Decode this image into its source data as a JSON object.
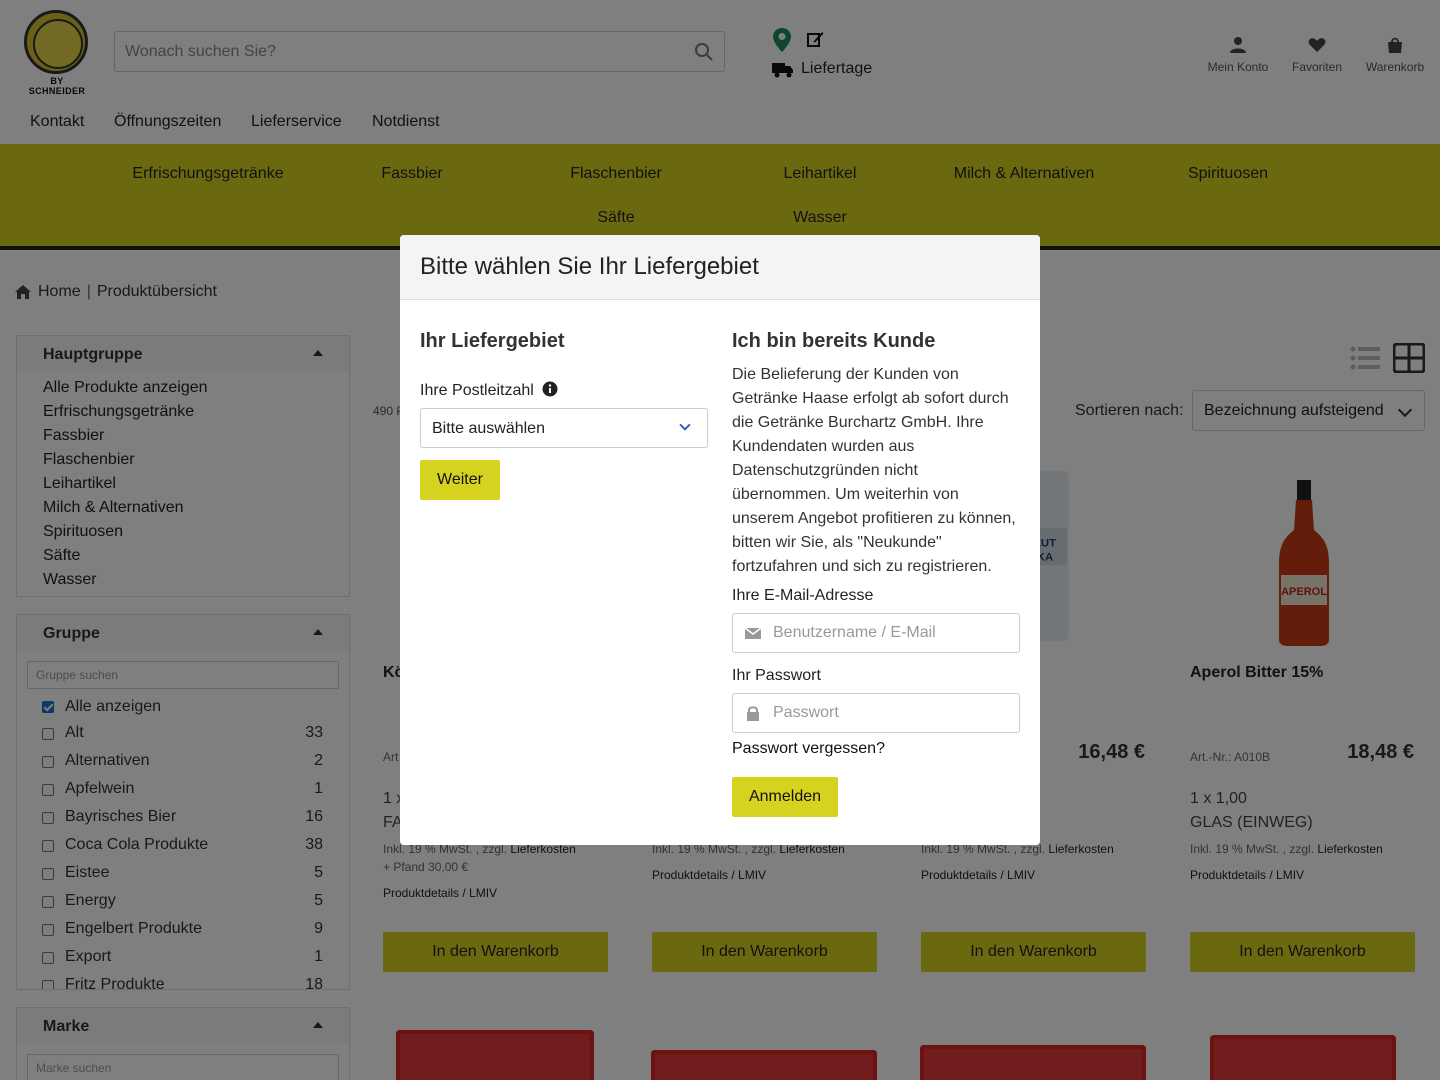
{
  "header": {
    "logo_text": "BY SCHNEIDER",
    "search_placeholder": "Wonach suchen Sie?",
    "liefertage": "Liefertage",
    "account": "Mein Konto",
    "favorites": "Favoriten",
    "cart": "Warenkorb"
  },
  "topnav": [
    "Kontakt",
    "Öffnungszeiten",
    "Lieferservice",
    "Notdienst"
  ],
  "categories": [
    "Erfrischungsgetränke",
    "Fassbier",
    "Flaschenbier",
    "Leihartikel",
    "Milch & Alternativen",
    "Spirituosen",
    "Säfte",
    "Wasser"
  ],
  "breadcrumb": {
    "home": "Home",
    "separator": "|",
    "current": "Produktübersicht"
  },
  "sidebar": {
    "hauptgruppe": {
      "title": "Hauptgruppe",
      "items": [
        "Alle Produkte anzeigen",
        "Erfrischungsgetränke",
        "Fassbier",
        "Flaschenbier",
        "Leihartikel",
        "Milch & Alternativen",
        "Spirituosen",
        "Säfte",
        "Wasser"
      ]
    },
    "gruppe": {
      "title": "Gruppe",
      "search_placeholder": "Gruppe suchen",
      "all_label": "Alle anzeigen",
      "items": [
        {
          "label": "Alt",
          "count": "33"
        },
        {
          "label": "Alternativen",
          "count": "2"
        },
        {
          "label": "Apfelwein",
          "count": "1"
        },
        {
          "label": "Bayrisches Bier",
          "count": "16"
        },
        {
          "label": "Coca Cola Produkte",
          "count": "38"
        },
        {
          "label": "Eistee",
          "count": "5"
        },
        {
          "label": "Energy",
          "count": "5"
        },
        {
          "label": "Engelbert Produkte",
          "count": "9"
        },
        {
          "label": "Export",
          "count": "1"
        },
        {
          "label": "Fritz Produkte",
          "count": "18"
        }
      ]
    },
    "marke": {
      "title": "Marke",
      "search_placeholder": "Marke suchen"
    }
  },
  "listing": {
    "count_text": "490 P",
    "sort_label": "Sortieren nach:",
    "sort_value": "Bezeichnung aufsteigend"
  },
  "products": [
    {
      "title": "Kö",
      "art": "Art",
      "price": "",
      "pack1": "1 x",
      "pack2": "FA",
      "tax_prefix": "Inkl. 19 % MwSt. , zzgl.",
      "tax_link": "Lieferkosten",
      "pfand": "+ Pfand 30,00 €",
      "details": "Produktdetails / LMIV",
      "button": "In den Warenkorb"
    },
    {
      "title": "",
      "art": "",
      "price": "",
      "pack1": "",
      "pack2": "",
      "tax_prefix": "Inkl. 19 % MwSt. , zzgl.",
      "tax_link": "Lieferkosten",
      "pfand": "",
      "details": "Produktdetails / LMIV",
      "button": "In den Warenkorb"
    },
    {
      "title": "",
      "art": "",
      "price": "16,48 €",
      "pack1": "",
      "pack2": "",
      "tax_prefix": "Inkl. 19 % MwSt. , zzgl.",
      "tax_link": "Lieferkosten",
      "pfand": "",
      "details": "Produktdetails / LMIV",
      "button": "In den Warenkorb"
    },
    {
      "title": "Aperol Bitter 15%",
      "art": "Art.-Nr.: A010B",
      "price": "18,48 €",
      "pack1": "1 x 1,00",
      "pack2": "GLAS (EINWEG)",
      "tax_prefix": "Inkl. 19 % MwSt. , zzgl.",
      "tax_link": "Lieferkosten",
      "pfand": "",
      "details": "Produktdetails / LMIV",
      "button": "In den Warenkorb"
    }
  ],
  "modal": {
    "title": "Bitte wählen Sie Ihr Liefergebiet",
    "left_heading": "Ihr Liefergebiet",
    "plz_label": "Ihre Postleitzahl",
    "plz_select": "Bitte auswählen",
    "continue_button": "Weiter",
    "right_heading": "Ich bin bereits Kunde",
    "info_text": "Die Belieferung der Kunden von Getränke Haase erfolgt ab sofort durch die Getränke Burchartz GmbH. Ihre Kundendaten wurden aus Datenschutzgründen nicht übernommen. Um weiterhin von unserem Angebot profitieren zu können, bitten wir Sie, als \"Neukunde\" fortzufahren und sich zu registrieren.",
    "email_label": "Ihre E-Mail-Adresse",
    "email_placeholder": "Benutzername / E-Mail",
    "password_label": "Ihr Passwort",
    "password_placeholder": "Passwort",
    "forgot": "Passwort vergessen?",
    "login_button": "Anmelden"
  },
  "colors": {
    "accent": "#d6d220",
    "overlay": "rgba(0,0,0,0.5)"
  }
}
